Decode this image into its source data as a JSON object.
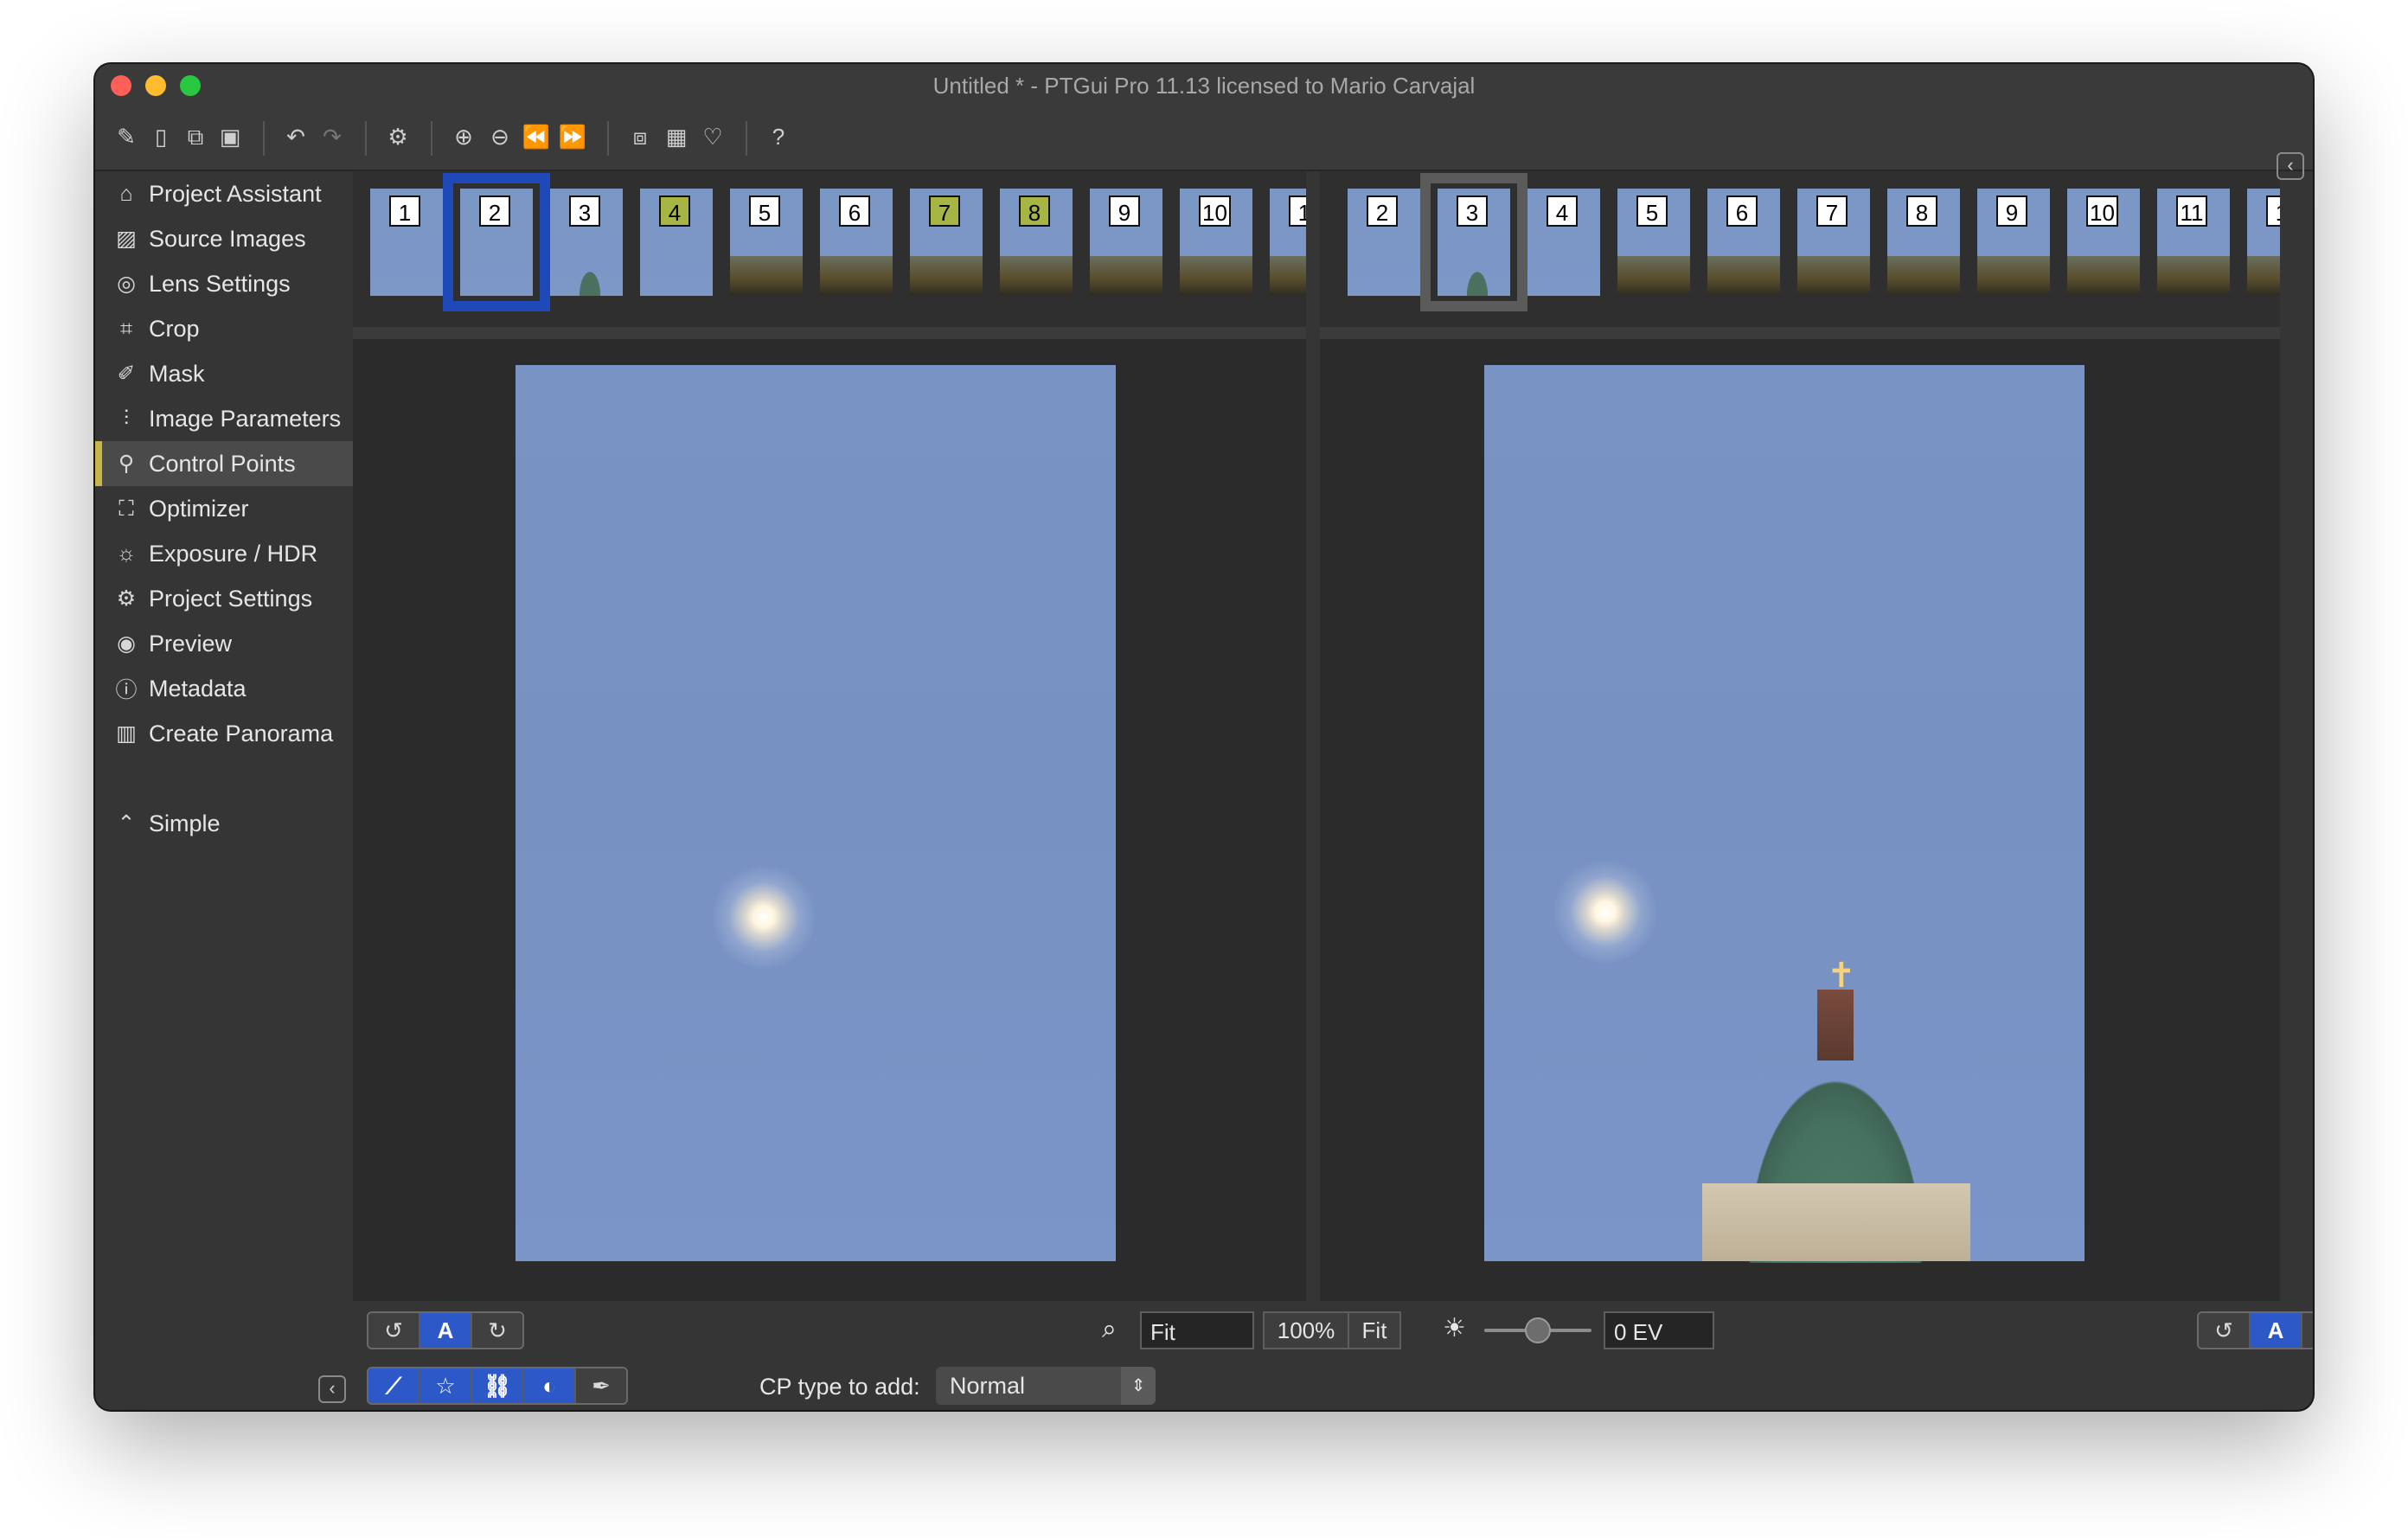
{
  "window": {
    "title": "Untitled * - PTGui Pro 11.13 licensed to Mario Carvajal"
  },
  "toolbar": {
    "icons": [
      "edit-icon",
      "new-document-icon",
      "copy-icon",
      "save-icon",
      "undo-icon",
      "redo-icon",
      "gear-icon",
      "zoom-in-icon",
      "zoom-out-icon",
      "rewind-icon",
      "fast-forward-icon",
      "layers-icon",
      "grid-icon",
      "lightbulb-icon",
      "help-icon"
    ],
    "glyphs": {
      "edit": "✎",
      "new": "▯",
      "copy": "⧉",
      "save": "▣",
      "undo": "↶",
      "redo": "↷",
      "gear": "⚙",
      "zoom_in": "⊕",
      "zoom_out": "⊖",
      "rewind": "⏪",
      "forward": "⏩",
      "layers": "⧈",
      "grid": "▦",
      "bulb": "♡",
      "help": "?"
    }
  },
  "sidebar": {
    "items": [
      {
        "label": "Project Assistant",
        "icon": "⌂"
      },
      {
        "label": "Source Images",
        "icon": "▨"
      },
      {
        "label": "Lens Settings",
        "icon": "◎"
      },
      {
        "label": "Crop",
        "icon": "⌗"
      },
      {
        "label": "Mask",
        "icon": "✐"
      },
      {
        "label": "Image Parameters",
        "icon": "⫶"
      },
      {
        "label": "Control Points",
        "icon": "⚲"
      },
      {
        "label": "Optimizer",
        "icon": "⛶"
      },
      {
        "label": "Exposure / HDR",
        "icon": "☼"
      },
      {
        "label": "Project Settings",
        "icon": "⚙"
      },
      {
        "label": "Preview",
        "icon": "◉"
      },
      {
        "label": "Metadata",
        "icon": "ⓘ"
      },
      {
        "label": "Create Panorama",
        "icon": "▥"
      }
    ],
    "active_index": 6,
    "simple": {
      "label": "Simple",
      "icon": "⌃"
    },
    "collapse_glyph": "‹"
  },
  "left_strip": {
    "thumbs": [
      "1",
      "2",
      "3",
      "4",
      "5",
      "6",
      "7",
      "8",
      "9",
      "10",
      "1"
    ],
    "cp_highlight": [
      "4",
      "7",
      "8"
    ],
    "selected": "2"
  },
  "right_strip": {
    "thumbs": [
      "2",
      "3",
      "4",
      "5",
      "6",
      "7",
      "8",
      "9",
      "10",
      "11",
      "1"
    ],
    "selected": "3"
  },
  "expand_glyph": "‹",
  "cross_glyph": "✝",
  "bottom": {
    "rotate_left_glyph": "↺",
    "auto_label": "A",
    "rotate_right_glyph": "↻",
    "zoom_glyph": "⌕",
    "zoom_value": "Fit",
    "btn_100": "100%",
    "btn_fit": "Fit",
    "sun_glyph": "☀",
    "exposure_slider": 0.5,
    "ev_value": "0 EV",
    "tools": [
      "⟋",
      "☆",
      "⛓",
      "◐",
      "✒"
    ],
    "cp_type_label": "CP type to add:",
    "cp_type_value": "Normal",
    "select_glyph": "⇕"
  },
  "colors": {
    "accent_blue": "#2d58c8",
    "selection_blue": "#1d4ab8",
    "active_marker": "#c8b54a",
    "cp_thumb": "#a6b543",
    "sky": "#7893c4"
  }
}
